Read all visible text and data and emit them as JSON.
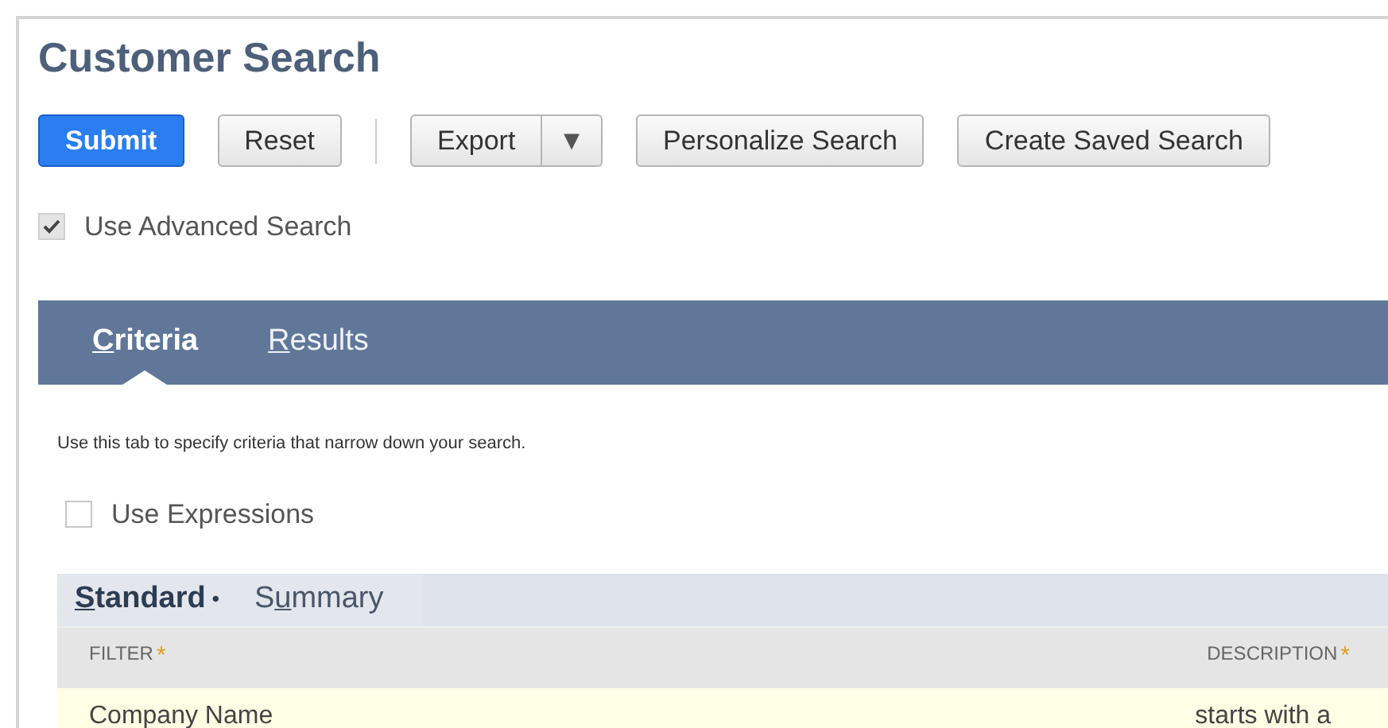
{
  "title": "Customer Search",
  "buttons": [
    {
      "label": "Submit",
      "kind": "primary"
    },
    {
      "label": "Reset",
      "kind": "plain"
    },
    {
      "kind": "separator"
    },
    {
      "label": "Export",
      "kind": "split",
      "caret": "▼"
    },
    {
      "label": "Personalize Search",
      "kind": "plain"
    },
    {
      "label": "Create Saved Search",
      "kind": "plain"
    }
  ],
  "advanced": {
    "label": "Use Advanced Search",
    "checked": true
  },
  "tabs": [
    {
      "label": {
        "key": "C",
        "rest": "riteria"
      },
      "selected": true
    },
    {
      "label": {
        "key": "R",
        "rest": "esults"
      },
      "selected": false
    }
  ],
  "hint": "Use this tab to specify criteria that narrow down your search.",
  "expressions": {
    "label": "Use Expressions",
    "checked": false
  },
  "subtabs": [
    {
      "label": {
        "key": "S",
        "rest": "tandard"
      },
      "selected": true,
      "marker": "•"
    },
    {
      "label": {
        "lead": "S",
        "key": "u",
        "rest": "mmary"
      },
      "selected": false
    }
  ],
  "table": {
    "columns": [
      {
        "label": "FILTER",
        "required": "*"
      },
      {
        "label": "DESCRIPTION",
        "required": "*"
      }
    ],
    "rows": [
      [
        "Company Name",
        "starts with a"
      ]
    ]
  }
}
